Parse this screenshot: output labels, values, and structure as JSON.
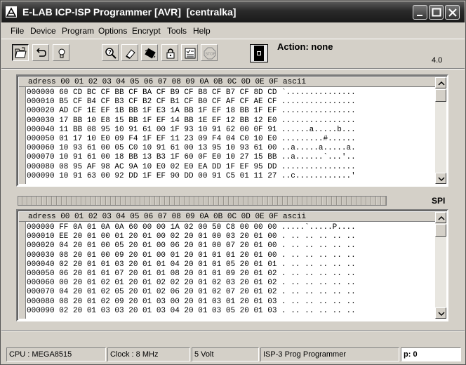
{
  "window": {
    "title": "E-LAB ICP-ISP Programmer [AVR]  [centralka]"
  },
  "menu": [
    "File",
    "Device",
    "Program",
    "Options",
    "Encrypt",
    "Tools",
    "Help"
  ],
  "toolbar": {
    "action_label": "Action:",
    "action_value": "none",
    "version": "4.0",
    "stop_label": "STOP"
  },
  "flash_panel": {
    "header": "adress 00 01 02 03 04 05 06 07 08 09 0A 0B 0C 0D 0E 0F ascii",
    "rows": [
      "000000 60 CD BC CF BB CF BA CF B9 CF B8 CF B7 CF 8D CD `...............",
      "000010 B5 CF B4 CF B3 CF B2 CF B1 CF B0 CF AF CF AE CF ................",
      "000020 AD CF 1E EF 1B BB 1F E3 1A BB 1F EF 18 BB 1F EF ................",
      "000030 17 BB 10 E8 15 BB 1F EF 14 BB 1E EF 12 BB 12 E0 ................",
      "000040 11 BB 08 95 10 91 61 00 1F 93 10 91 62 00 0F 91 ......a.....b...",
      "000050 01 17 10 E0 09 F4 1F EF 11 23 09 F4 04 C0 10 E0 .........#......",
      "000060 10 93 61 00 05 C0 10 91 61 00 13 95 10 93 61 00 ..a.....a.....a.",
      "000070 10 91 61 00 18 BB 13 B3 1F 60 0F E0 10 27 15 BB ..a......`...'..",
      "000080 08 95 AF 98 AC 9A 10 E0 02 E0 EA DD 1F EF 95 DD ................",
      "000090 10 91 63 00 92 DD 1F EF 90 DD 00 91 C5 01 11 27 ..c............'"
    ]
  },
  "interface_label": "SPI",
  "eeprom_panel": {
    "header": "adress 00 01 02 03 04 05 06 07 08 09 0A 0B 0C 0D 0E 0F ascii",
    "rows": [
      "000000 FF 0A 01 0A 0A 60 00 00 1A 02 00 50 C8 00 00 00 .....`.....P....",
      "000010 EE 20 01 00 01 20 01 00 02 20 01 00 03 20 01 00 . .. .. .. .. ..",
      "000020 04 20 01 00 05 20 01 00 06 20 01 00 07 20 01 00 . .. .. .. .. ..",
      "000030 08 20 01 00 09 20 01 00 01 20 01 01 01 20 01 00 . .. .. .. .. ..",
      "000040 02 20 01 01 03 20 01 01 04 20 01 01 05 20 01 01 . .. .. .. .. ..",
      "000050 06 20 01 01 07 20 01 01 08 20 01 01 09 20 01 02 . .. .. .. .. ..",
      "000060 00 20 01 02 01 20 01 02 02 20 01 02 03 20 01 02 . .. .. .. .. ..",
      "000070 04 20 01 02 05 20 01 02 06 20 01 02 07 20 01 02 . .. .. .. .. ..",
      "000080 08 20 01 02 09 20 01 03 00 20 01 03 01 20 01 03 . .. .. .. .. ..",
      "000090 02 20 01 03 03 20 01 03 04 20 01 03 05 20 01 03 . .. .. .. .. .."
    ]
  },
  "status": {
    "cpu": "CPU : MEGA8515",
    "clock": "Clock : 8 MHz",
    "voltage": "5 Volt",
    "programmer": "ISP-3 Prog Programmer",
    "position": "p: 0"
  }
}
